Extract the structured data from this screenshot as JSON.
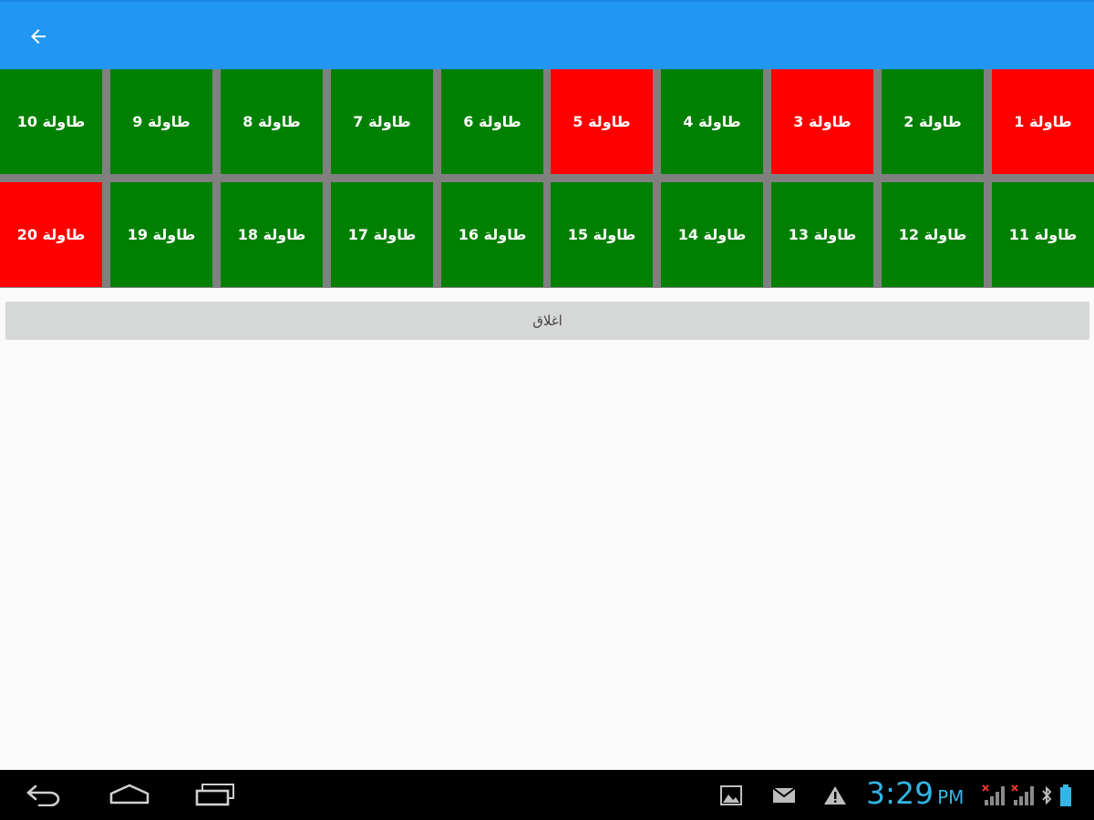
{
  "colors": {
    "appbar": "#2196f3",
    "available": "#008000",
    "occupied": "#ff0000",
    "grid_gap": "#808080",
    "close_button_bg": "#d6d7d7",
    "clock": "#33b5e5"
  },
  "appbar": {
    "back_icon": "arrow-left-icon"
  },
  "tables": [
    {
      "label": "طاولة 1",
      "status": "occupied"
    },
    {
      "label": "طاولة 2",
      "status": "available"
    },
    {
      "label": "طاولة 3",
      "status": "occupied"
    },
    {
      "label": "طاولة 4",
      "status": "available"
    },
    {
      "label": "طاولة 5",
      "status": "occupied"
    },
    {
      "label": "طاولة 6",
      "status": "available"
    },
    {
      "label": "طاولة 7",
      "status": "available"
    },
    {
      "label": "طاولة 8",
      "status": "available"
    },
    {
      "label": "طاولة 9",
      "status": "available"
    },
    {
      "label": "طاولة 10",
      "status": "available"
    },
    {
      "label": "طاولة 11",
      "status": "available"
    },
    {
      "label": "طاولة 12",
      "status": "available"
    },
    {
      "label": "طاولة 13",
      "status": "available"
    },
    {
      "label": "طاولة 14",
      "status": "available"
    },
    {
      "label": "طاولة 15",
      "status": "available"
    },
    {
      "label": "طاولة 16",
      "status": "available"
    },
    {
      "label": "طاولة 17",
      "status": "available"
    },
    {
      "label": "طاولة 18",
      "status": "available"
    },
    {
      "label": "طاولة 19",
      "status": "available"
    },
    {
      "label": "طاولة 20",
      "status": "occupied"
    }
  ],
  "close_button": {
    "label": "اغلاق"
  },
  "system_bar": {
    "nav_icons": [
      "back-icon",
      "home-icon",
      "recent-apps-icon"
    ],
    "status_icons": [
      "gallery-icon",
      "mail-icon",
      "warning-icon",
      "signal-no-service-icon",
      "signal-no-service-icon",
      "battery-icon"
    ],
    "time": "3:29",
    "ampm": "PM"
  }
}
